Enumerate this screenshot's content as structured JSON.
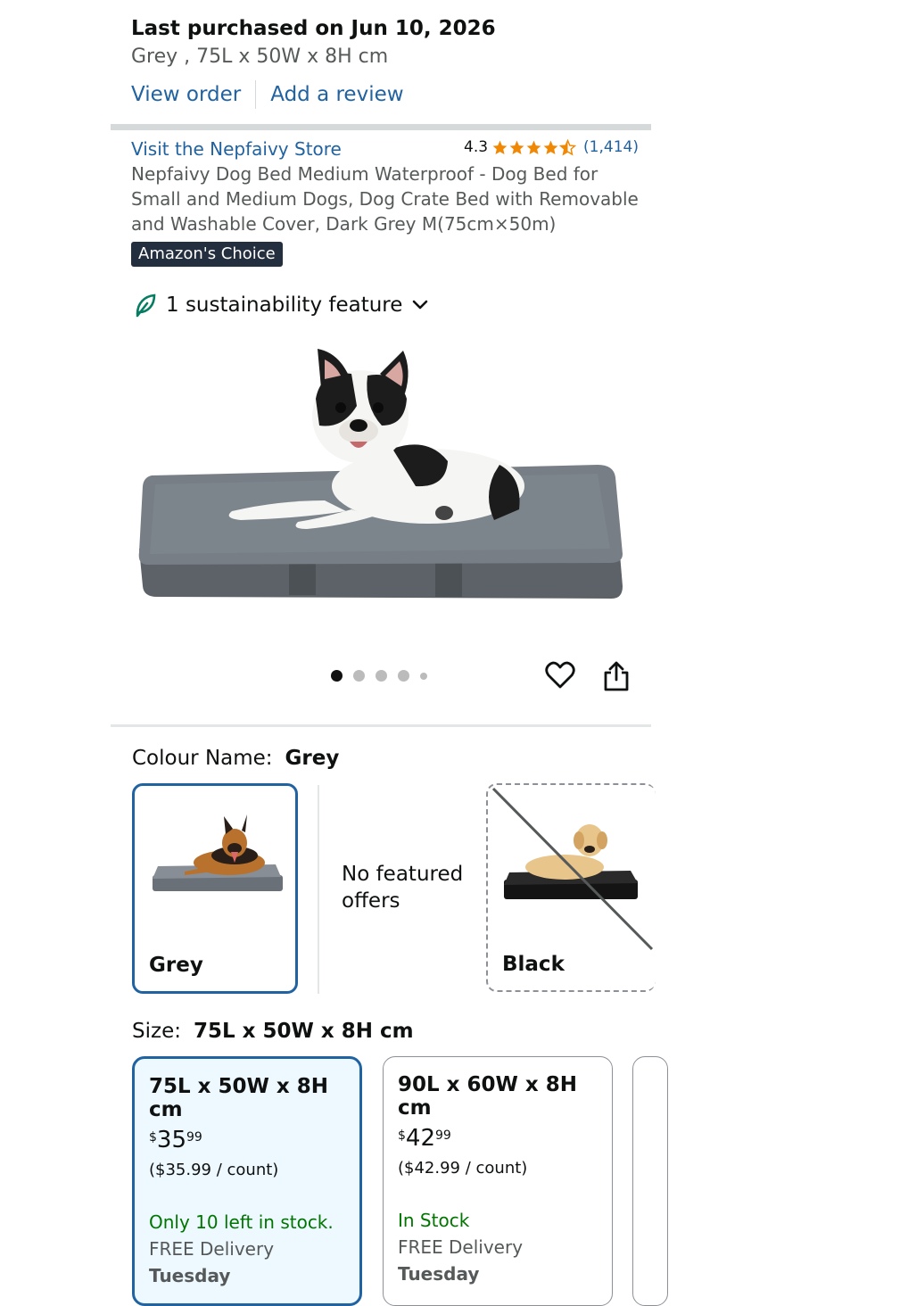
{
  "purchase": {
    "title": "Last purchased on Jun 10, 2026",
    "variant": "Grey , 75L x 50W x 8H cm",
    "view_order": "View order",
    "add_review": "Add a review"
  },
  "product": {
    "store_link": "Visit the Nepfaivy Store",
    "rating_value": "4.3",
    "rating_stars": 4.3,
    "rating_count": "(1,414)",
    "title": "Nepfaivy Dog Bed Medium Waterproof - Dog Bed for Small and Medium Dogs, Dog Crate Bed with Removable and Washable Cover, Dark Grey M(75cm×50m)",
    "badge": "Amazon's Choice",
    "sustainability": "1 sustainability feature"
  },
  "carousel": {
    "total": 5,
    "active": 1
  },
  "icons": {
    "leaf": "leaf-icon",
    "chevron": "chevron-down-icon",
    "heart": "heart-icon",
    "share": "share-icon",
    "star": "star-icon"
  },
  "colour": {
    "label": "Colour Name:",
    "selected": "Grey",
    "options": [
      {
        "name": "Grey",
        "available": true
      },
      {
        "name": "",
        "note": "No featured offers"
      },
      {
        "name": "Black",
        "available": false
      }
    ]
  },
  "size": {
    "label": "Size:",
    "selected": "75L x 50W x 8H cm",
    "options": [
      {
        "name": "75L x 50W x 8H cm",
        "currency": "$",
        "whole": "35",
        "fraction": "99",
        "per_count": "($35.99 / count)",
        "stock": "Only 10 left in stock.",
        "delivery": "FREE Delivery",
        "day": "Tuesday"
      },
      {
        "name": "90L x 60W x 8H cm",
        "currency": "$",
        "whole": "42",
        "fraction": "99",
        "per_count": "($42.99 / count)",
        "stock": "In Stock",
        "delivery": "FREE Delivery",
        "day": "Tuesday"
      }
    ]
  },
  "colors": {
    "link": "#2162a1",
    "star": "#f08804",
    "badge": "#232f3e",
    "selected_border": "#2162a1",
    "in_stock": "#007600",
    "leaf": "#067d62"
  }
}
